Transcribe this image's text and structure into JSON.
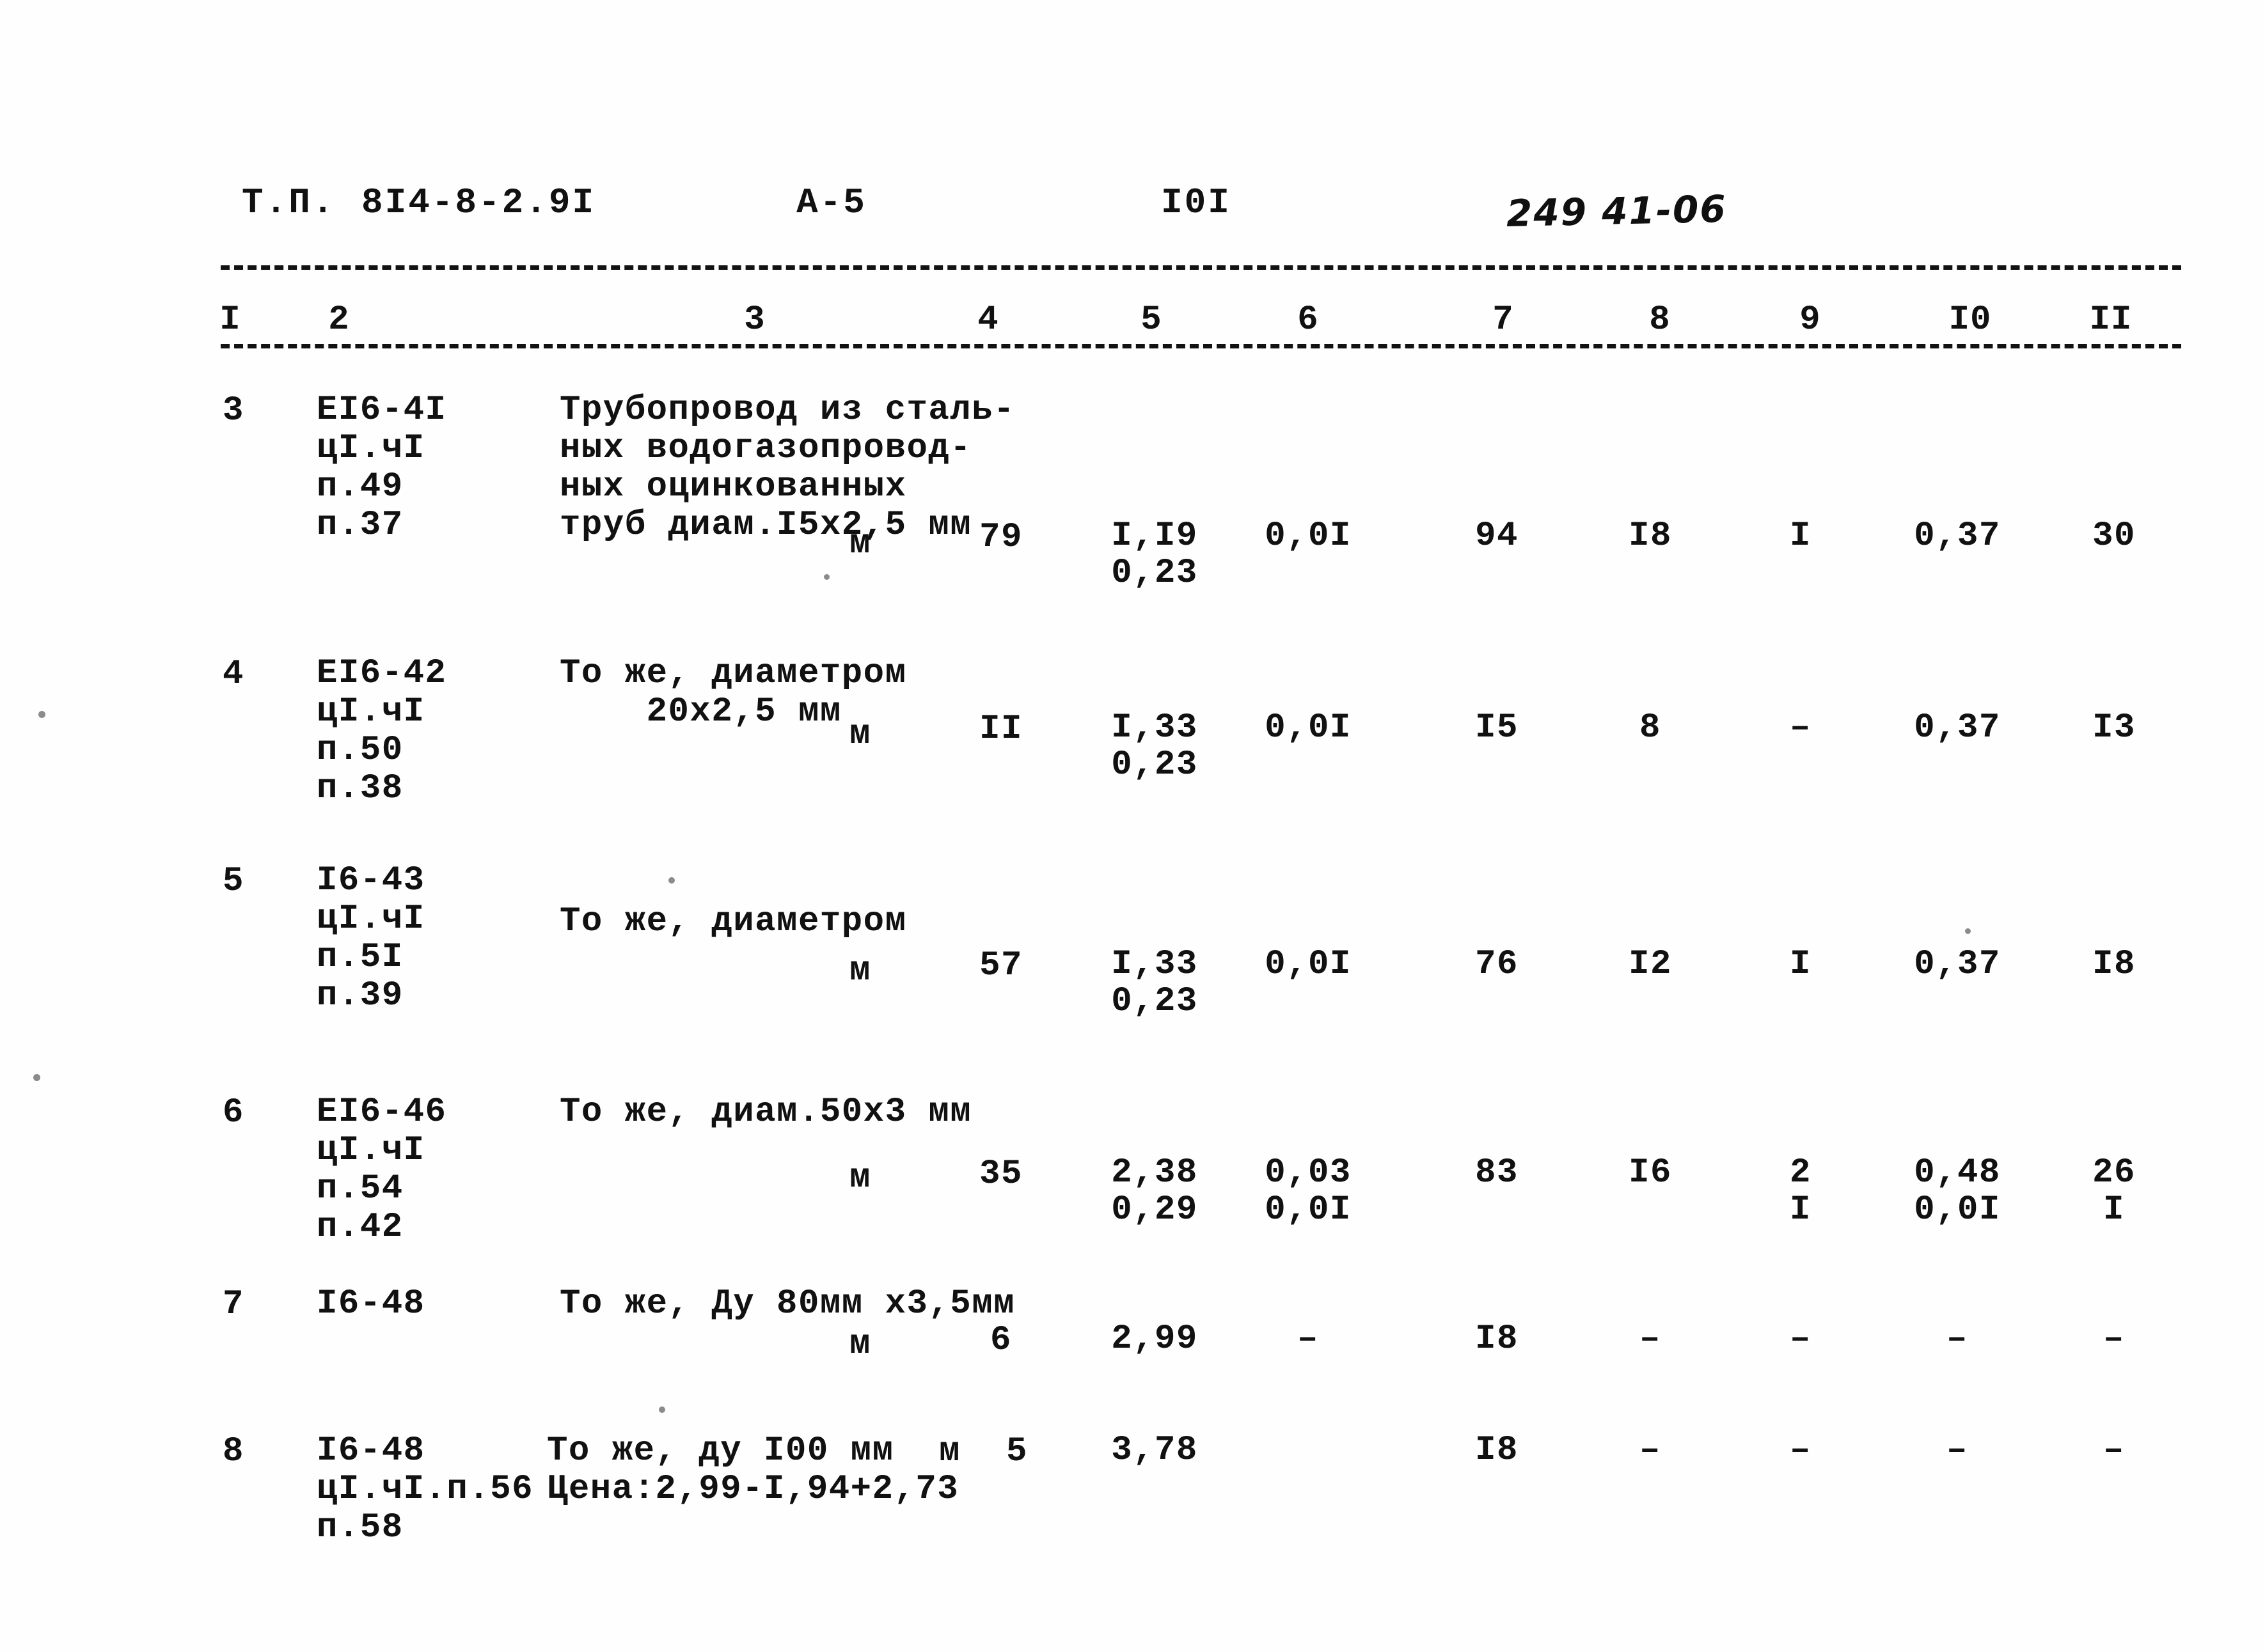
{
  "document": {
    "series_label": "Т.П.",
    "series_code": "8I4-8-2.9I",
    "section": "А-5",
    "page_number": "I0I",
    "handwritten_stamp": "249 41-06"
  },
  "table": {
    "column_numbers": [
      "I",
      "2",
      "3",
      "4",
      "5",
      "6",
      "7",
      "8",
      "9",
      "I0",
      "II"
    ],
    "rows": [
      {
        "num": "3",
        "code_lines": [
          "ЕI6-4I",
          "цI.чI",
          "п.49",
          "п.37"
        ],
        "description_lines": [
          "Трубопровод из сталь-",
          "ных водогазопровод-",
          "ных оцинкованных",
          "труб диам.I5х2,5 мм"
        ],
        "unit": "м",
        "qty": "79",
        "c5_top": "I,I9",
        "c5_bottom": "0,23",
        "c6_top": "0,0I",
        "c6_bottom": "",
        "c7_top": "94",
        "c7_bottom": "",
        "c8_top": "I8",
        "c8_bottom": "",
        "c9_top": "I",
        "c9_bottom": "",
        "c10_top": "0,37",
        "c10_bottom": "",
        "c11_top": "30",
        "c11_bottom": ""
      },
      {
        "num": "4",
        "code_lines": [
          "ЕI6-42",
          "цI.чI",
          "п.50",
          "п.38"
        ],
        "description_lines": [
          "То же, диаметром",
          "    20х2,5 мм"
        ],
        "unit": "м",
        "qty": "II",
        "c5_top": "I,33",
        "c5_bottom": "0,23",
        "c6_top": "0,0I",
        "c6_bottom": "",
        "c7_top": "I5",
        "c7_bottom": "",
        "c8_top": "8",
        "c8_bottom": "",
        "c9_top": "–",
        "c9_bottom": "",
        "c10_top": "0,37",
        "c10_bottom": "",
        "c11_top": "I3",
        "c11_bottom": ""
      },
      {
        "num": "5",
        "code_lines": [
          "I6-43",
          "цI.чI",
          "п.5I",
          "п.39"
        ],
        "description_lines": [
          "То же, диаметром"
        ],
        "unit": "м",
        "qty": "57",
        "c5_top": "I,33",
        "c5_bottom": "0,23",
        "c6_top": "0,0I",
        "c6_bottom": "",
        "c7_top": "76",
        "c7_bottom": "",
        "c8_top": "I2",
        "c8_bottom": "",
        "c9_top": "I",
        "c9_bottom": "",
        "c10_top": "0,37",
        "c10_bottom": "",
        "c11_top": "I8",
        "c11_bottom": ""
      },
      {
        "num": "6",
        "code_lines": [
          "ЕI6-46",
          "цI.чI",
          "п.54",
          "п.42"
        ],
        "description_lines": [
          "То же, диам.50х3 мм"
        ],
        "unit": "м",
        "qty": "35",
        "c5_top": "2,38",
        "c5_bottom": "0,29",
        "c6_top": "0,03",
        "c6_bottom": "0,0I",
        "c7_top": "83",
        "c7_bottom": "",
        "c8_top": "I6",
        "c8_bottom": "",
        "c9_top": "2",
        "c9_bottom": "I",
        "c10_top": "0,48",
        "c10_bottom": "0,0I",
        "c11_top": "26",
        "c11_bottom": "I"
      },
      {
        "num": "7",
        "code_lines": [
          "I6-48"
        ],
        "description_lines": [
          "То же, Ду 80мм х3,5мм"
        ],
        "unit": "м",
        "qty": "6",
        "c5_top": "2,99",
        "c5_bottom": "",
        "c6_top": "–",
        "c6_bottom": "",
        "c7_top": "I8",
        "c7_bottom": "",
        "c8_top": "–",
        "c8_bottom": "",
        "c9_top": "–",
        "c9_bottom": "",
        "c10_top": "–",
        "c10_bottom": "",
        "c11_top": "–",
        "c11_bottom": ""
      },
      {
        "num": "8",
        "code_lines": [
          "I6-48",
          "цI.чI.п.56",
          "п.58"
        ],
        "description_lines": [
          "То же, ду I00 мм",
          "Цена:2,99-I,94+2,73"
        ],
        "unit": "м",
        "qty": "5",
        "c5_top": "3,78",
        "c5_bottom": "",
        "c6_top": "",
        "c6_bottom": "",
        "c7_top": "I8",
        "c7_bottom": "",
        "c8_top": "–",
        "c8_bottom": "",
        "c9_top": "–",
        "c9_bottom": "",
        "c10_top": "–",
        "c10_bottom": "",
        "c11_top": "–",
        "c11_bottom": ""
      }
    ]
  }
}
